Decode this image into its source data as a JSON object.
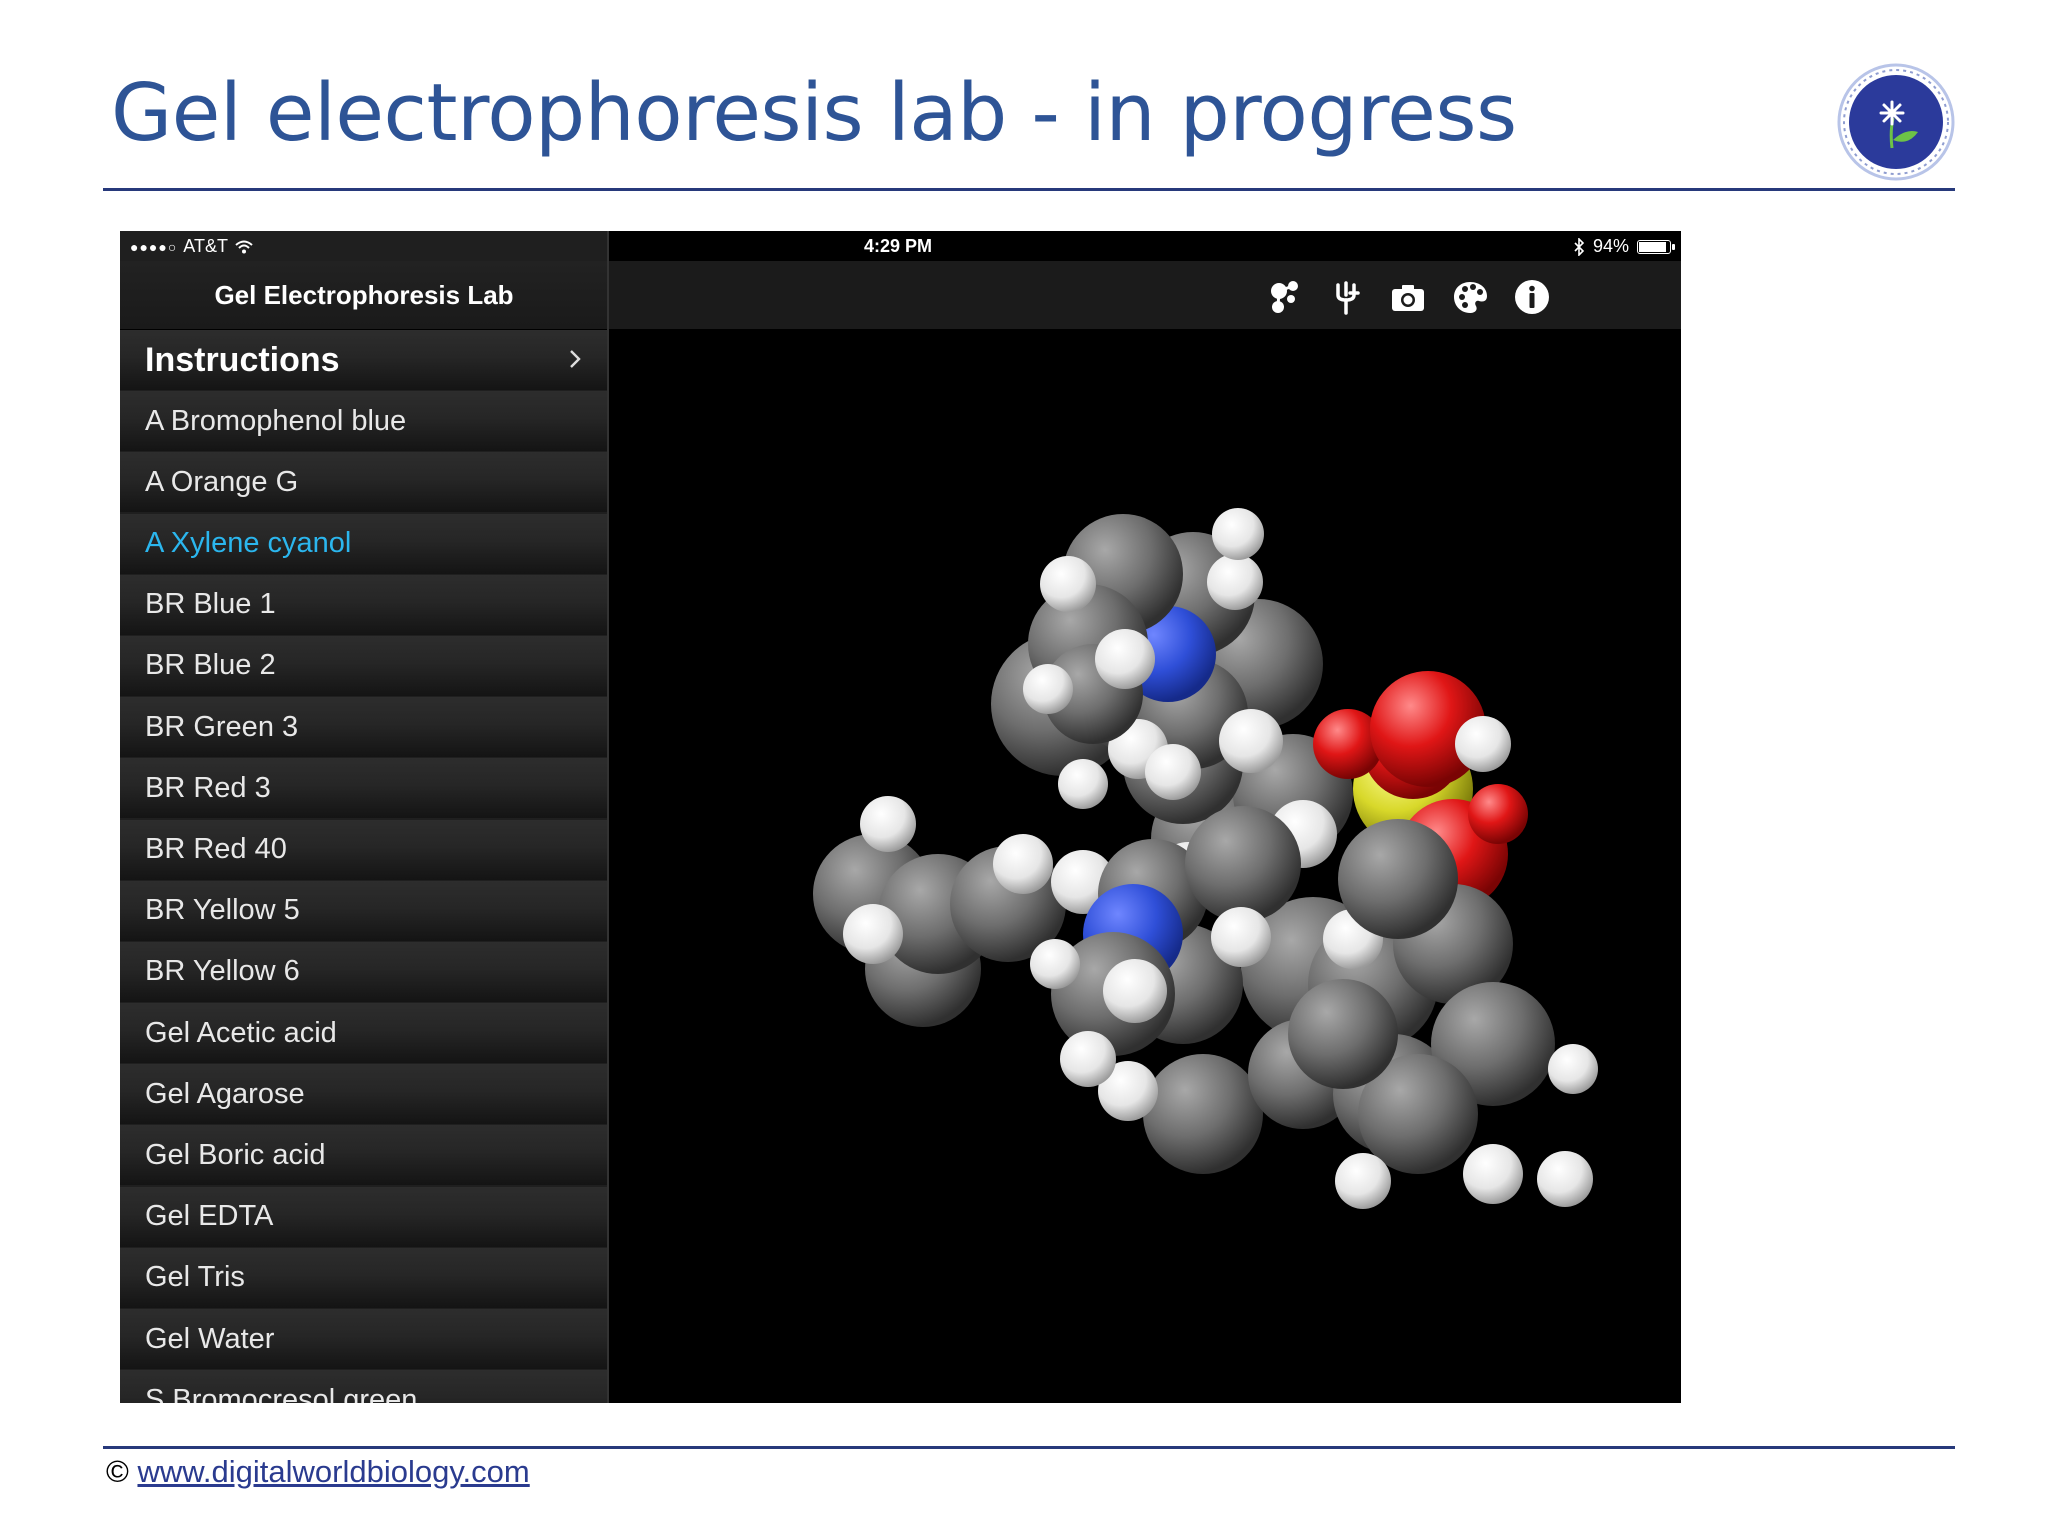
{
  "slide": {
    "title": "Gel electrophoresis lab - in progress",
    "footer_copyright": "©",
    "footer_link": "www.digitalworldbiology.com",
    "title_color": "#2e5496"
  },
  "status_bar": {
    "signal": "●●●●○",
    "carrier": "AT&T",
    "time": "4:29 PM",
    "battery": "94%",
    "battery_level": 0.94
  },
  "sidebar": {
    "title": "Gel Electrophoresis Lab",
    "selected_color": "#2bb6ee",
    "items": [
      {
        "label": "Instructions",
        "heading": true
      },
      {
        "label": "A Bromophenol blue"
      },
      {
        "label": "A Orange G"
      },
      {
        "label": "A Xylene cyanol",
        "selected": true
      },
      {
        "label": "BR Blue 1"
      },
      {
        "label": "BR Blue 2"
      },
      {
        "label": "BR Green 3"
      },
      {
        "label": "BR Red 3"
      },
      {
        "label": "BR Red 40"
      },
      {
        "label": "BR Yellow 5"
      },
      {
        "label": "BR Yellow 6"
      },
      {
        "label": "Gel Acetic acid"
      },
      {
        "label": "Gel Agarose"
      },
      {
        "label": "Gel Boric acid"
      },
      {
        "label": "Gel EDTA"
      },
      {
        "label": "Gel Tris"
      },
      {
        "label": "Gel Water"
      },
      {
        "label": "S Bromocresol green"
      }
    ]
  },
  "toolbar": {
    "icons": [
      "molecule-style-icon",
      "tuning-fork-icon",
      "camera-icon",
      "palette-icon",
      "info-icon"
    ]
  },
  "viewer": {
    "atom_colors": {
      "carbon": "#7a7a7a",
      "hydrogen": "#f2f2f2",
      "nitrogen": "#2f4fd8",
      "oxygen": "#e01616",
      "sulfur": "#d8d82a"
    }
  }
}
